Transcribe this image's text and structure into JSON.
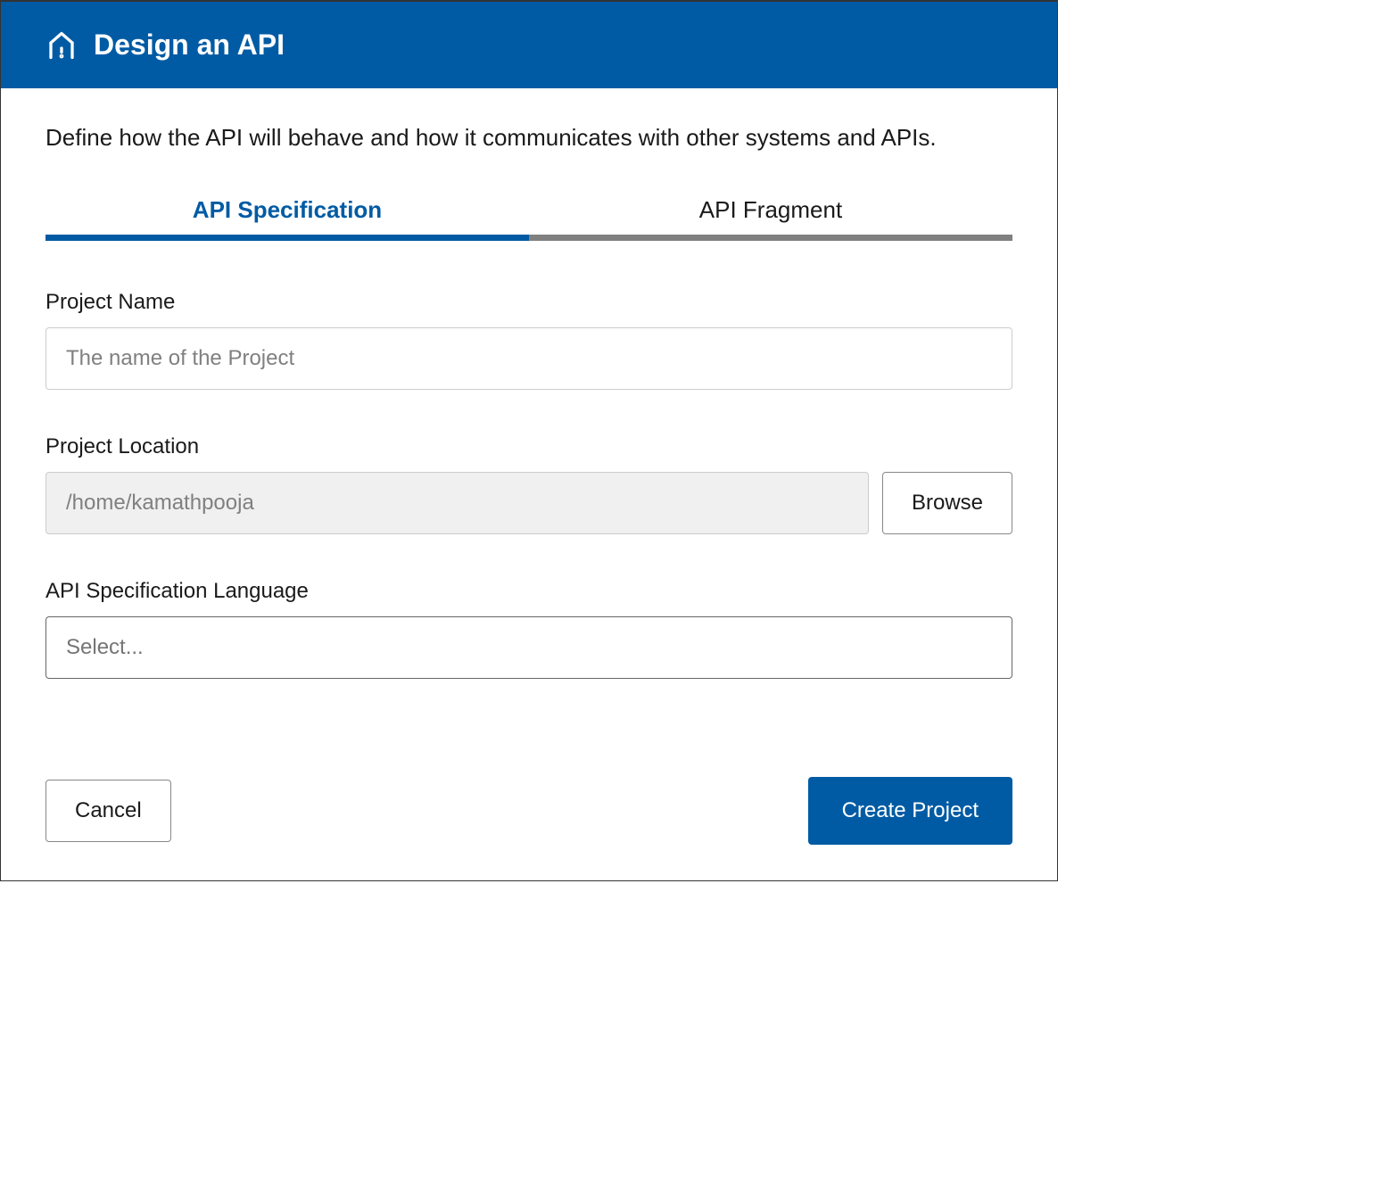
{
  "header": {
    "title": "Design an API"
  },
  "description": "Define how the API will behave and how it communicates with other systems and APIs.",
  "tabs": {
    "spec": "API Specification",
    "fragment": "API Fragment"
  },
  "form": {
    "projectName": {
      "label": "Project Name",
      "placeholder": "The name of the Project"
    },
    "projectLocation": {
      "label": "Project Location",
      "value": "/home/kamathpooja",
      "browse": "Browse"
    },
    "specLanguage": {
      "label": "API Specification Language",
      "placeholder": "Select..."
    }
  },
  "buttons": {
    "cancel": "Cancel",
    "create": "Create Project"
  }
}
